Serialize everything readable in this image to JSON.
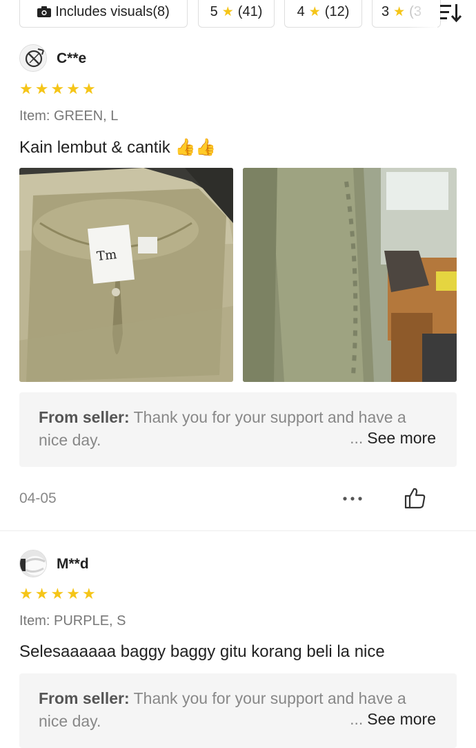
{
  "filters": {
    "visuals_label": "Includes visuals(8)",
    "five": {
      "stars": "5",
      "count": "(41)"
    },
    "four": {
      "stars": "4",
      "count": "(12)"
    },
    "three": {
      "stars": "3",
      "count": "(3"
    }
  },
  "reviews": [
    {
      "user": "C**e",
      "rating": 5,
      "variant": "Item: GREEN, L",
      "comment": "Kain lembut & cantik 👍👍",
      "seller_label": "From seller:",
      "seller_reply": " Thank you for your support and have a nice day.",
      "see_more_dots": "...",
      "see_more": "See more",
      "date": "04-05"
    },
    {
      "user": "M**d",
      "rating": 5,
      "variant": "Item: PURPLE, S",
      "comment": "Selesaaaaaa baggy baggy gitu korang beli la nice",
      "seller_label": "From seller:",
      "seller_reply": " Thank you for your support and have a nice day.",
      "see_more_dots": "...",
      "see_more": "See more"
    }
  ],
  "icons": {
    "camera": "camera-icon",
    "star": "star-icon",
    "sort": "sort-icon",
    "more": "more-dots-icon",
    "like": "thumbs-up-icon"
  },
  "colors": {
    "star": "#f5c518",
    "seller_bg": "#f5f5f5",
    "muted": "#888888"
  }
}
